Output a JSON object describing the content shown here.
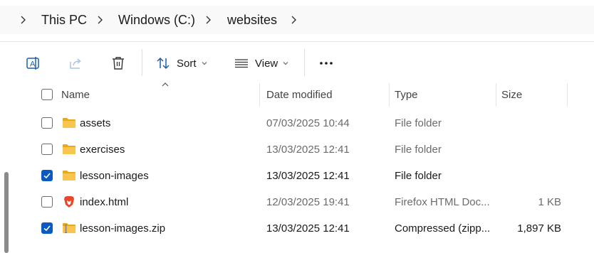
{
  "breadcrumb": {
    "items": [
      "This PC",
      "Windows (C:)",
      "websites"
    ]
  },
  "commandbar": {
    "sort_label": "Sort",
    "view_label": "View",
    "more_label": "•••"
  },
  "columns": {
    "name": "Name",
    "date": "Date modified",
    "type": "Type",
    "size": "Size"
  },
  "files": [
    {
      "name": "assets",
      "date": "07/03/2025 10:44",
      "type": "File folder",
      "size": "",
      "icon": "folder-icon",
      "checked": false
    },
    {
      "name": "exercises",
      "date": "13/03/2025 12:41",
      "type": "File folder",
      "size": "",
      "icon": "folder-icon",
      "checked": false
    },
    {
      "name": "lesson-images",
      "date": "13/03/2025 12:41",
      "type": "File folder",
      "size": "",
      "icon": "folder-icon",
      "checked": true
    },
    {
      "name": "index.html",
      "date": "12/03/2025 19:41",
      "type": "Firefox HTML Doc...",
      "size": "1 KB",
      "icon": "brave-html-icon",
      "checked": false
    },
    {
      "name": "lesson-images.zip",
      "date": "13/03/2025 12:41",
      "type": "Compressed (zipp...",
      "size": "1,897 KB",
      "icon": "zip-folder-icon",
      "checked": true
    }
  ],
  "colors": {
    "accent": "#0a5ac2",
    "folder": "#f3c34b"
  }
}
